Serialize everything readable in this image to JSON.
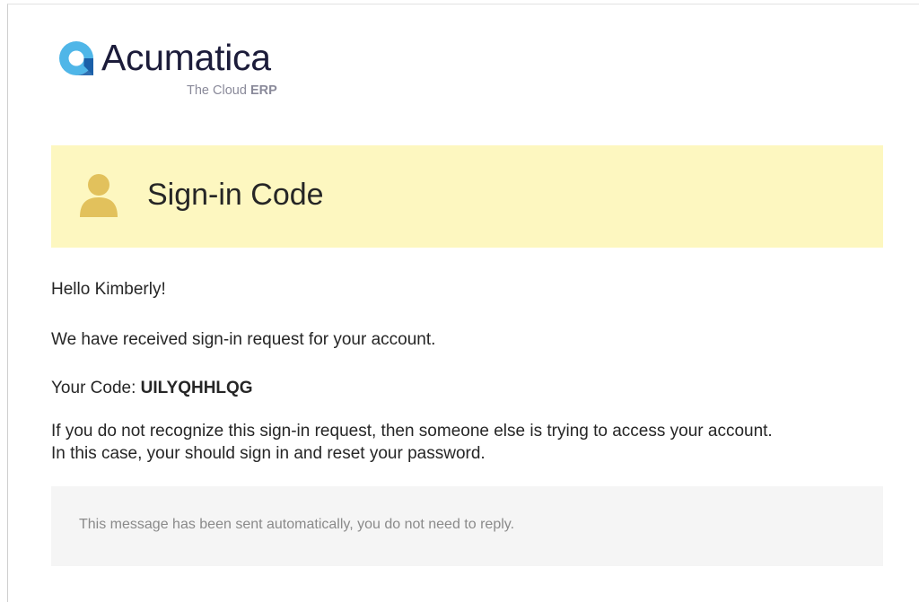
{
  "logo": {
    "icon": "acumatica-logo-mark",
    "name": "Acumatica",
    "tagline_prefix": "The Cloud",
    "tagline_emphasis": "ERP",
    "colors": {
      "mark_light": "#4fb6e8",
      "mark_dark": "#1a5fa8",
      "wordmark": "#1c1c3a"
    }
  },
  "banner": {
    "icon": "user-icon",
    "title": "Sign-in Code",
    "background": "#fdf7c0",
    "icon_color": "#e2c15c"
  },
  "message": {
    "greeting": "Hello Kimberly!",
    "received": "We have received sign-in request for your account.",
    "code_label": "Your Code:",
    "code_value": "UILYQHHLQG",
    "warning_line1": "If you do not recognize this sign-in request, then someone else is trying to access your account.",
    "warning_line2": "In this case, your should sign in and reset your password."
  },
  "footer": {
    "text": "This message has been sent automatically, you do not need to reply."
  }
}
